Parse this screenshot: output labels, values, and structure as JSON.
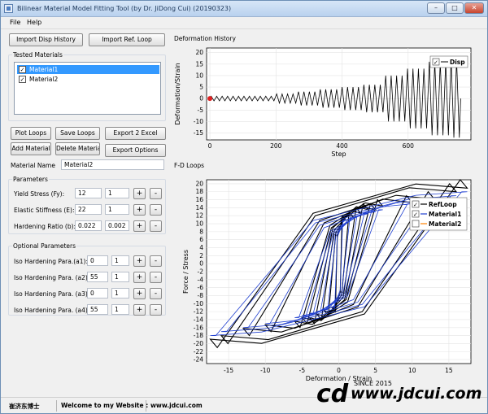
{
  "window": {
    "title": "Bilinear Material Model Fitting Tool (by Dr. JiDong Cui) (20190323)",
    "minimize": "–",
    "maximize": "□",
    "close": "✕",
    "icon": "app-icon"
  },
  "menu": [
    "File",
    "Help"
  ],
  "buttons": {
    "import_disp": "Import Disp History",
    "import_ref": "Import Ref. Loop",
    "plot_loops": "Plot Loops",
    "save_loops": "Save Loops",
    "export_excel": "Export 2 Excel",
    "add_material": "Add Material",
    "delete_material": "Delete Material",
    "export_options": "Export Options"
  },
  "tested_materials": {
    "label": "Tested Materials",
    "items": [
      {
        "label": "Material1",
        "checked": true,
        "selected": true
      },
      {
        "label": "Material2",
        "checked": true,
        "selected": false
      }
    ]
  },
  "material_name": {
    "label": "Material Name",
    "value": "Material2"
  },
  "parameters": {
    "label": "Parameters",
    "rows": [
      {
        "label": "Yield Stress (Fy):",
        "v1": "12",
        "v2": "1"
      },
      {
        "label": "Elastic Stiffness (E):",
        "v1": "22",
        "v2": "1"
      },
      {
        "label": "Hardening Ratio (b):",
        "v1": "0.022",
        "v2": "0.002"
      }
    ]
  },
  "optional": {
    "label": "Optional Parameters",
    "rows": [
      {
        "label": "Iso Hardening Para.(a1):",
        "v1": "0",
        "v2": "1"
      },
      {
        "label": "Iso Hardening Para. (a2):",
        "v1": "55",
        "v2": "1"
      },
      {
        "label": "Iso Hardening Para. (a3):",
        "v1": "0",
        "v2": "1"
      },
      {
        "label": "Iso Hardening Para. (a4):",
        "v1": "55",
        "v2": "1"
      }
    ]
  },
  "plus": "+",
  "minus": "-",
  "check": "✓",
  "status": {
    "author": "崔济东博士",
    "welcome": "Welcome to my Website :",
    "site": "www.jdcui.com"
  },
  "watermark": {
    "logo": "cd",
    "text": "www.jdcui.com",
    "since": "SINCE 2015"
  },
  "chart_data": [
    {
      "type": "line",
      "title": "Deformation History",
      "xlabel": "Step",
      "ylabel": "Deformation/Strain",
      "xlim": [
        -10,
        790
      ],
      "ylim": [
        -18,
        22
      ],
      "xticks": [
        0,
        200,
        400,
        600
      ],
      "yticks": [
        20,
        15,
        10,
        5,
        0,
        -5,
        -10,
        -15
      ],
      "legend": {
        "label": "Disp",
        "checked": true,
        "placement": "top-right"
      },
      "series": [
        {
          "name": "Disp",
          "color": "#000000",
          "amplitudes": [
            1,
            1,
            1,
            1,
            1,
            1,
            1,
            1,
            1,
            1,
            1,
            1,
            2,
            2,
            2,
            2,
            3,
            3,
            3,
            3,
            4,
            4,
            4,
            4,
            5,
            5,
            5,
            5,
            6,
            6,
            6,
            6,
            10,
            10,
            10,
            10,
            13,
            13,
            13,
            13,
            16,
            16,
            16,
            16,
            17,
            17
          ],
          "step_per_cycle": 16.5,
          "start_marker": {
            "x": 0,
            "y": 0,
            "color": "#e02020"
          }
        }
      ],
      "grid": true
    },
    {
      "type": "line",
      "title": "F-D Loops",
      "xlabel": "Deformation / Strain",
      "ylabel": "Force / Stress",
      "xlim": [
        -18,
        18
      ],
      "ylim": [
        -25,
        21
      ],
      "xticks": [
        -15,
        -10,
        -5,
        0,
        5,
        10,
        15
      ],
      "yticks": [
        20,
        18,
        16,
        14,
        12,
        10,
        8,
        6,
        4,
        2,
        0,
        -2,
        -4,
        -6,
        -8,
        -10,
        -12,
        -14,
        -16,
        -18,
        -20,
        -22,
        -24
      ],
      "legend": [
        {
          "label": "RefLoop",
          "checked": true,
          "color": "#000000"
        },
        {
          "label": "Material1",
          "checked": true,
          "color": "#1f3fd0"
        },
        {
          "label": "Material2",
          "checked": false,
          "color": "#ff8000"
        }
      ],
      "ref_loops": [
        {
          "xmax": 1,
          "fy": 12
        },
        {
          "xmax": 2,
          "fy": 13
        },
        {
          "xmax": 3,
          "fy": 14
        },
        {
          "xmax": 4,
          "fy": 15
        },
        {
          "xmax": 5,
          "fy": 15
        },
        {
          "xmax": 6,
          "fy": 16
        },
        {
          "xmax": 10,
          "fy": 17
        },
        {
          "xmax": 13,
          "fy": 18
        },
        {
          "xmax": 16,
          "fy": 20
        },
        {
          "xmax": 17.5,
          "fy": 21
        }
      ],
      "material1_loops": [
        {
          "xmax": 1,
          "fy": 11
        },
        {
          "xmax": 2,
          "fy": 11.5
        },
        {
          "xmax": 3,
          "fy": 12
        },
        {
          "xmax": 4,
          "fy": 12.5
        },
        {
          "xmax": 5,
          "fy": 13
        },
        {
          "xmax": 6,
          "fy": 13.5
        },
        {
          "xmax": 10,
          "fy": 15
        },
        {
          "xmax": 13,
          "fy": 16
        },
        {
          "xmax": 16,
          "fy": 17
        },
        {
          "xmax": 17.5,
          "fy": 18
        }
      ],
      "grid": true
    }
  ]
}
